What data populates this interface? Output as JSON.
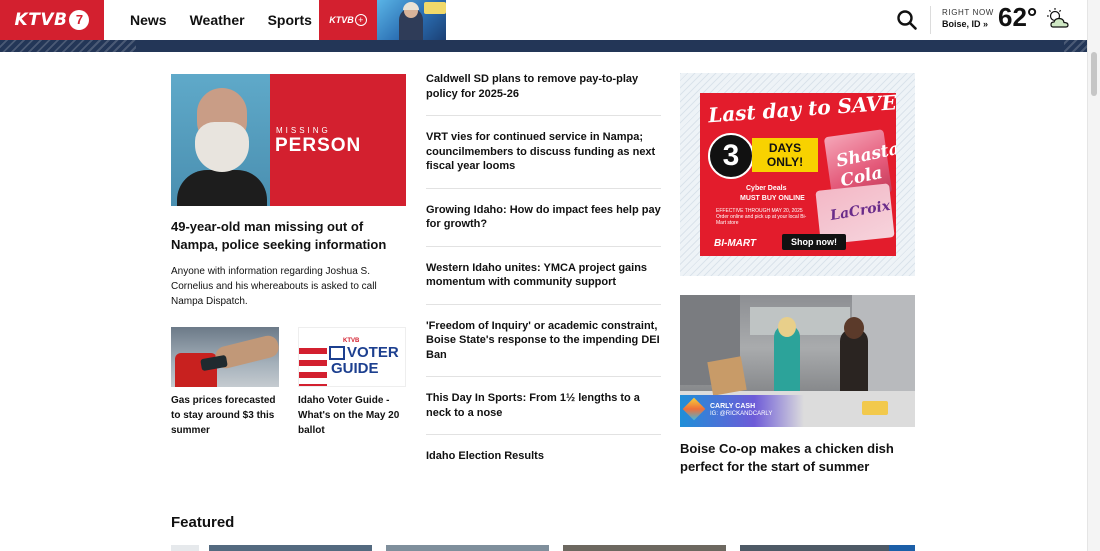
{
  "header": {
    "logo_text": "KTVB",
    "logo_badge": "7",
    "nav": [
      "News",
      "Weather",
      "Sports"
    ],
    "plus_label": "KTVB",
    "plus_badge": "+",
    "weather": {
      "right_now_label": "RIGHT NOW",
      "location": "Boise, ID »",
      "temperature": "62°",
      "condition_icon": "partly-cloudy-icon"
    }
  },
  "hero": {
    "image_overlay_small": "MISSING",
    "image_overlay_large": "PERSON",
    "title": "49-year-old man missing out of Nampa, police seeking information",
    "summary": "Anyone with information regarding Joshua S. Cornelius and his whereabouts is asked to call Nampa Dispatch."
  },
  "thumbs": [
    {
      "title": "Gas prices forecasted to stay around $3 this summer"
    },
    {
      "title": "Idaho Voter Guide - What's on the May 20 ballot",
      "image_text_brand": "KTVB",
      "image_text_1": "VOTER",
      "image_text_2": "GUIDE"
    }
  ],
  "stories": [
    "Caldwell SD plans to remove pay-to-play policy for 2025-26",
    "VRT vies for continued service in Nampa; councilmembers to discuss funding as next fiscal year looms",
    "Growing Idaho: How do impact fees help pay for growth?",
    "Western Idaho unites: YMCA project gains momentum with community support",
    "'Freedom of Inquiry' or academic constraint, Boise State's response to the impending DEI Ban",
    "This Day In Sports: From 1½ lengths to a neck to a nose",
    "Idaho Election Results"
  ],
  "ad": {
    "headline": "Last day to SAVE!",
    "days_number": "3",
    "days_text": "DAYS ONLY!",
    "can_text": "Shasta Cola",
    "box_text": "LaCroix",
    "cyber": "Cyber Deals",
    "buy": "MUST BUY ONLINE",
    "fine_print": "EFFECTIVE THROUGH MAY 20, 2025 Order online and pick up at your local Bi-Mart store",
    "brand": "BI-MART",
    "cta": "Shop now!"
  },
  "video": {
    "lower_third_name": "CARLY CASH",
    "lower_third_handle": "IG: @RICKANDCARLY",
    "title": "Boise Co-op makes a chicken dish perfect for the start of summer"
  },
  "featured": {
    "heading": "Featured"
  },
  "colors": {
    "brand_red": "#d3202f",
    "nav_stripe": "#233657",
    "ad_red": "#e31c2c"
  }
}
